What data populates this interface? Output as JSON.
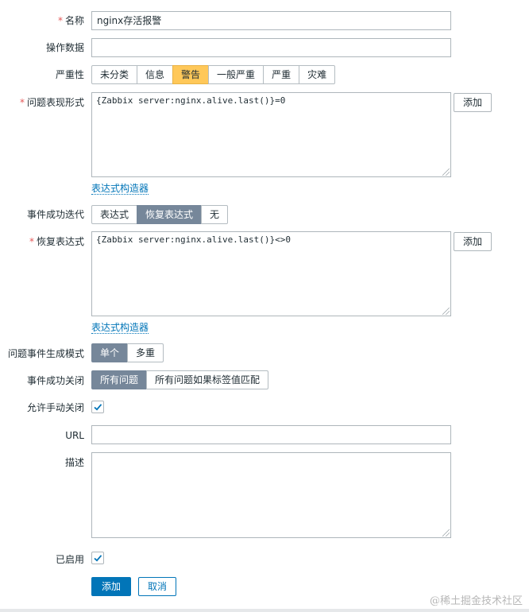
{
  "form": {
    "name": {
      "required_mark": "*",
      "label": "名称",
      "value": "nginx存活报警"
    },
    "operational_data": {
      "label": "操作数据",
      "value": ""
    },
    "severity": {
      "label": "严重性",
      "options": [
        "未分类",
        "信息",
        "警告",
        "一般严重",
        "严重",
        "灾难"
      ],
      "selected": "警告"
    },
    "problem_expression": {
      "required_mark": "*",
      "label": "问题表现形式",
      "value": "{Zabbix server:nginx.alive.last()}=0",
      "add_label": "添加",
      "builder_link": "表达式构造器"
    },
    "ok_event_generation": {
      "label": "事件成功迭代",
      "options": [
        "表达式",
        "恢复表达式",
        "无"
      ],
      "selected": "恢复表达式"
    },
    "recovery_expression": {
      "required_mark": "*",
      "label": "恢复表达式",
      "value": "{Zabbix server:nginx.alive.last()}<>0",
      "add_label": "添加",
      "builder_link": "表达式构造器"
    },
    "problem_event_mode": {
      "label": "问题事件生成模式",
      "options": [
        "单个",
        "多重"
      ],
      "selected": "单个"
    },
    "ok_event_closes": {
      "label": "事件成功关闭",
      "options": [
        "所有问题",
        "所有问题如果标签值匹配"
      ],
      "selected": "所有问题"
    },
    "allow_manual_close": {
      "label": "允许手动关闭",
      "checked": true
    },
    "url": {
      "label": "URL",
      "value": ""
    },
    "description": {
      "label": "描述",
      "value": ""
    },
    "enabled": {
      "label": "已启用",
      "checked": true
    },
    "actions": {
      "submit_label": "添加",
      "cancel_label": "取消"
    }
  },
  "watermark": "@稀土掘金技术社区",
  "colors": {
    "accent": "#0275b8",
    "segment_active": "#76879a",
    "severity_warning": "#ffc859",
    "required": "#e45959"
  }
}
